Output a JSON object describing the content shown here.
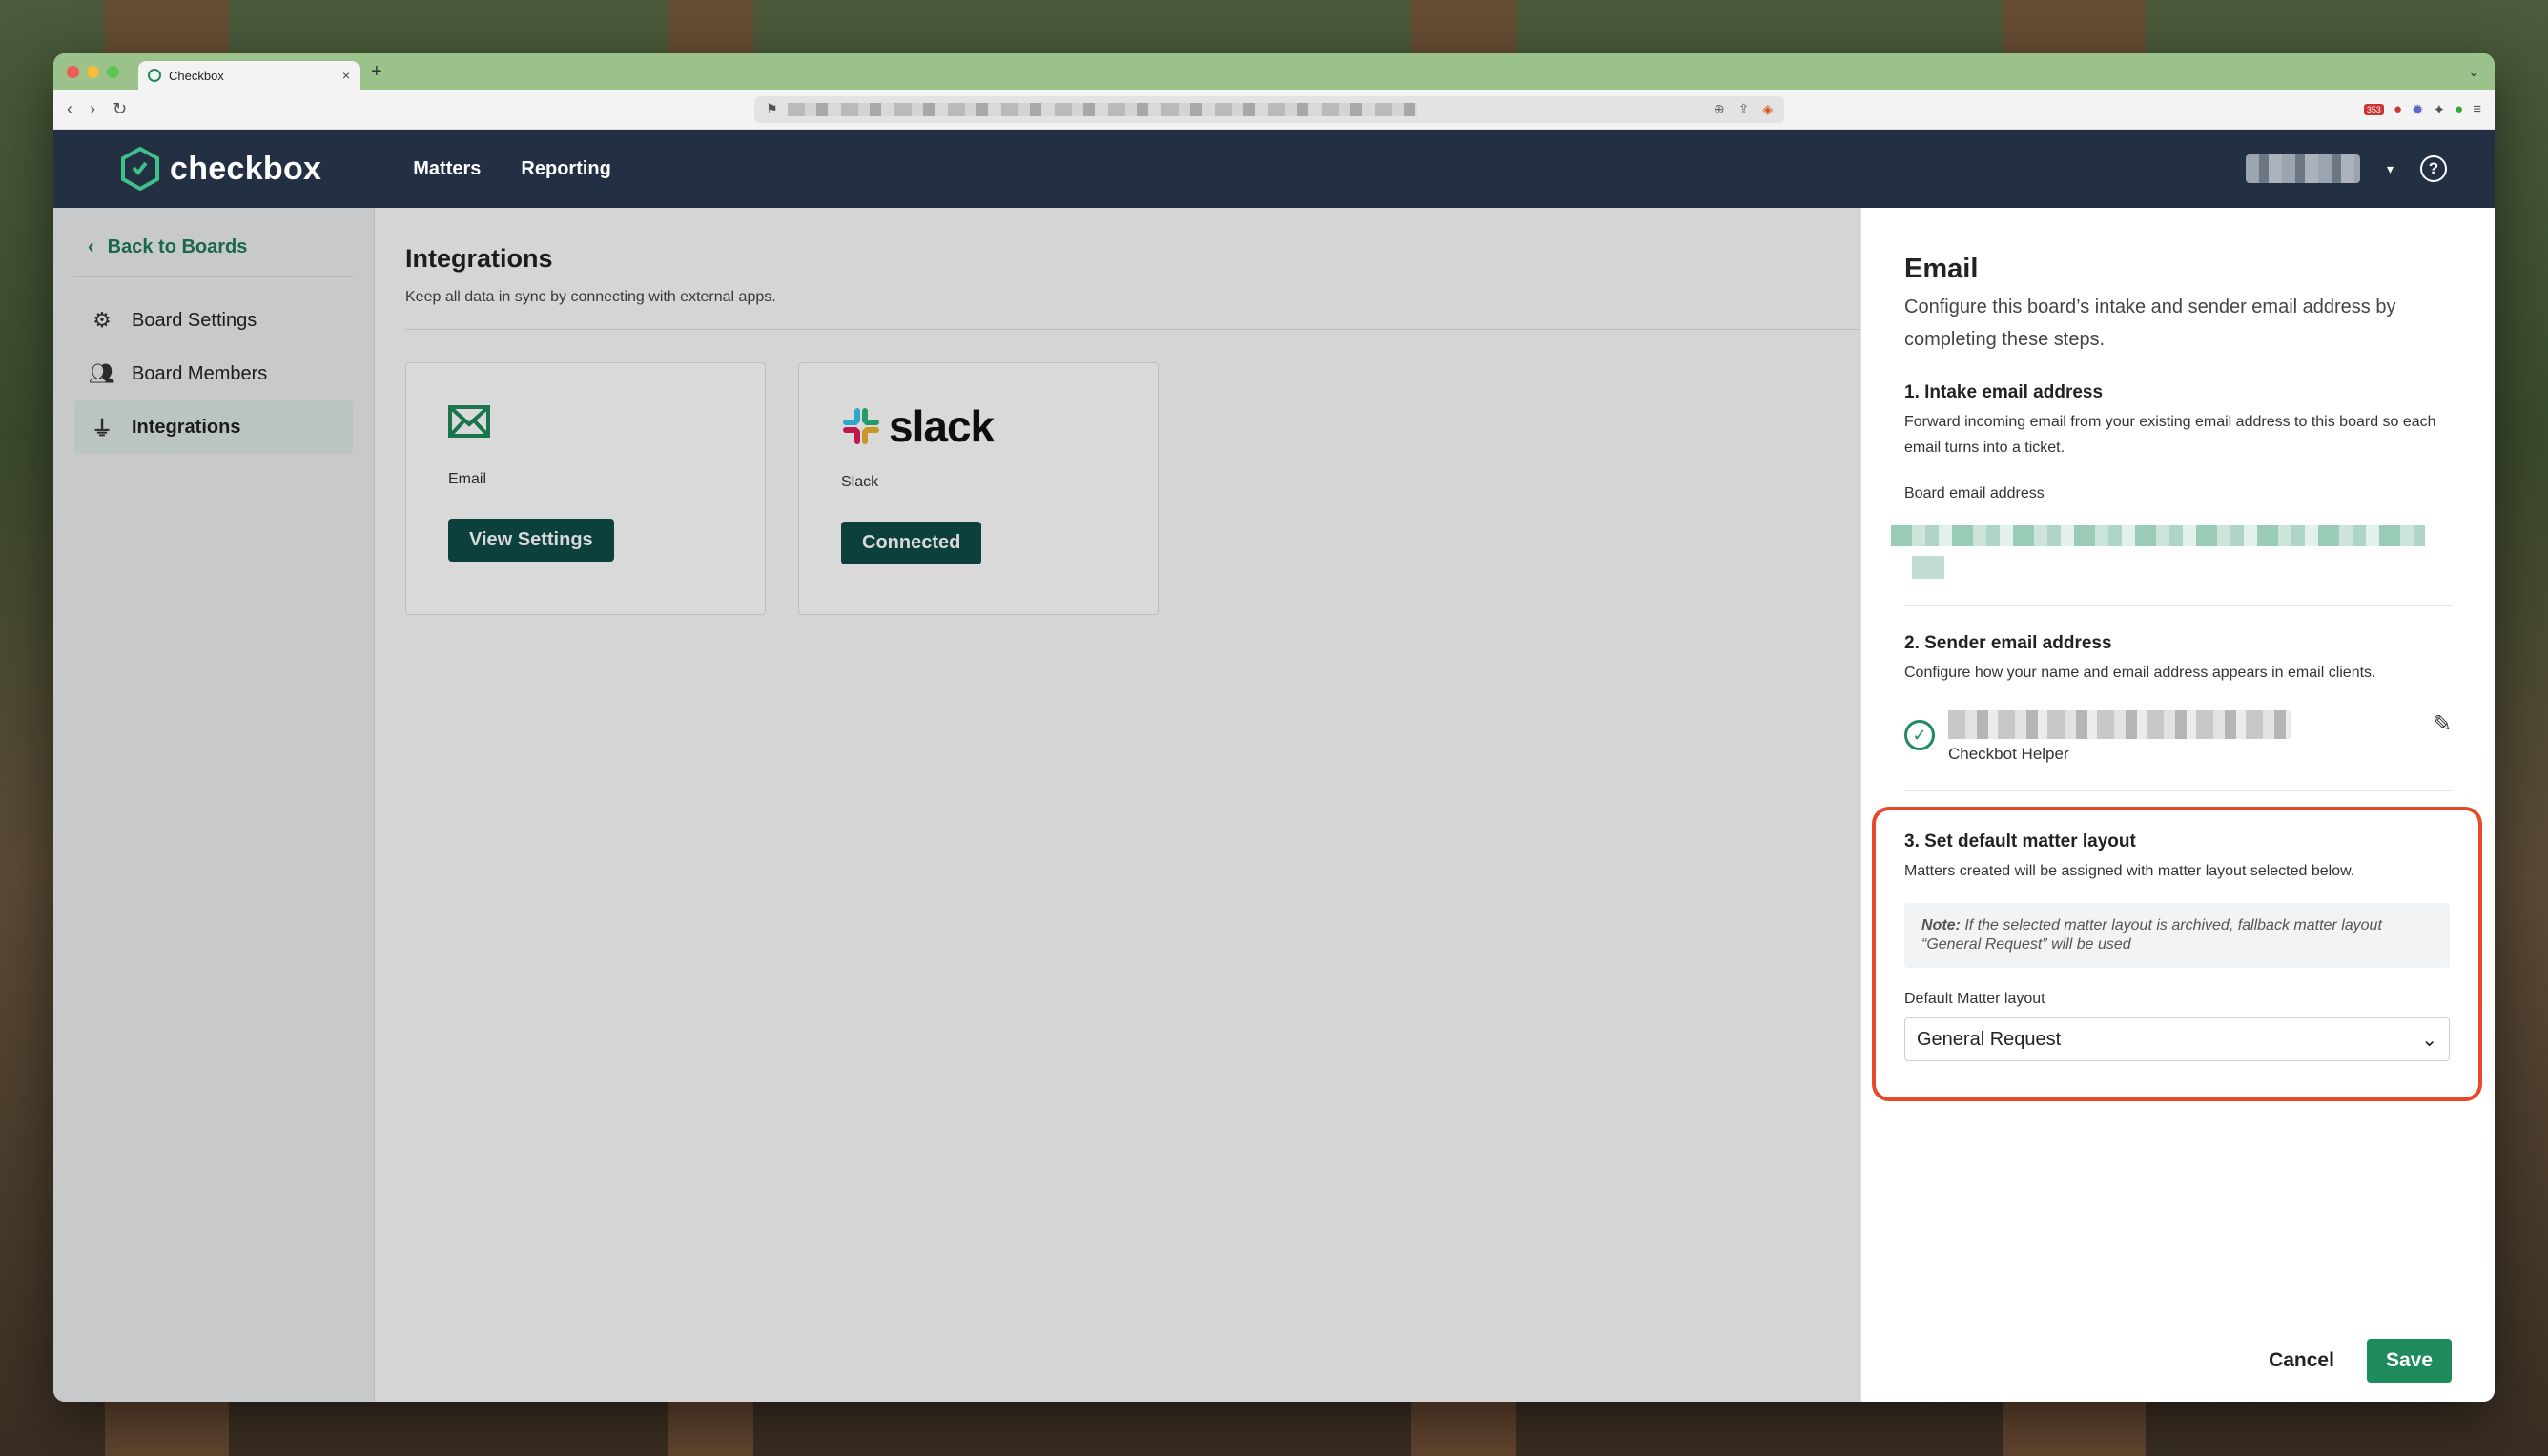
{
  "browser": {
    "tab_title": "Checkbox",
    "new_tab_symbol": "+",
    "close_symbol": "×",
    "ext_badge_count": "353"
  },
  "app": {
    "logo_text": "checkbox",
    "nav": [
      "Matters",
      "Reporting"
    ],
    "help_symbol": "?"
  },
  "sidebar": {
    "back_label": "Back to Boards",
    "items": [
      {
        "label": "Board Settings",
        "icon": "gear-icon"
      },
      {
        "label": "Board Members",
        "icon": "users-icon"
      },
      {
        "label": "Integrations",
        "icon": "plug-icon"
      }
    ]
  },
  "main": {
    "title": "Integrations",
    "subtitle": "Keep all data in sync by connecting with external apps.",
    "cards": [
      {
        "label": "Email",
        "button": "View Settings"
      },
      {
        "label": "Slack",
        "button": "Connected",
        "logo_word": "slack"
      }
    ]
  },
  "panel": {
    "title": "Email",
    "description": "Configure this board’s intake and sender email address by completing these steps.",
    "step1": {
      "title": "1. Intake email address",
      "desc": "Forward incoming email from your existing email address to this board so each email turns into a ticket.",
      "field_label": "Board email address"
    },
    "step2": {
      "title": "2. Sender email address",
      "desc": "Configure how your name and email address appears in email clients.",
      "sender_name": "Checkbot Helper"
    },
    "step3": {
      "title": "3. Set default matter layout",
      "desc": "Matters created will be assigned with matter layout selected below.",
      "note_label": "Note:",
      "note_text": "If the selected matter layout is archived, fallback matter layout “General Request” will be used",
      "select_label": "Default Matter layout",
      "select_value": "General Request"
    },
    "cancel_label": "Cancel",
    "save_label": "Save"
  },
  "colors": {
    "nav_bg": "#233044",
    "primary_green": "#1f8a5b",
    "dark_button": "#0f4c47",
    "highlight": "#e6492b"
  }
}
